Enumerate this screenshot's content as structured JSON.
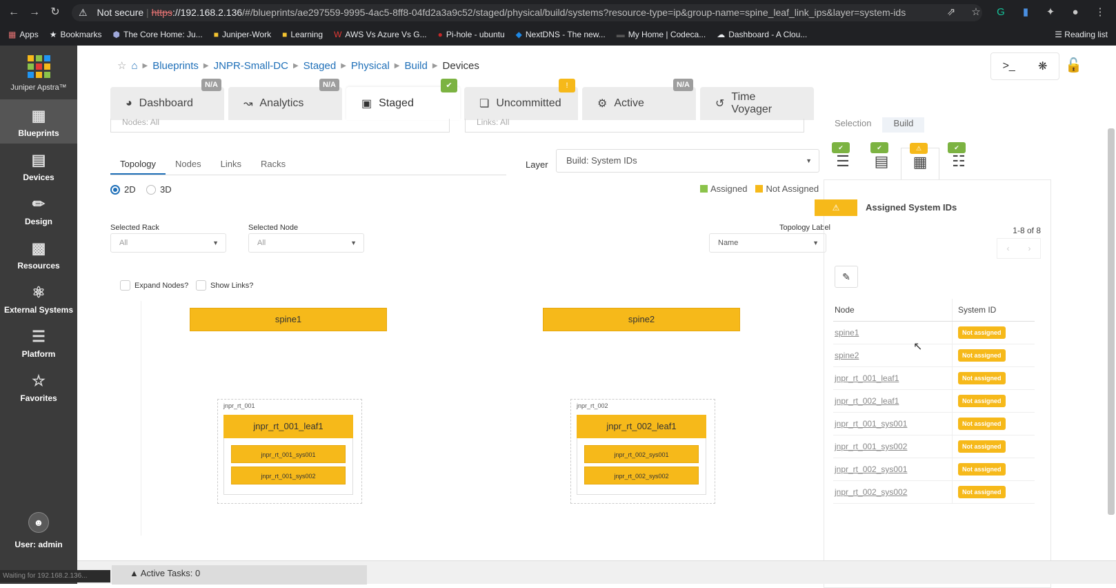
{
  "browser": {
    "security": "Not secure",
    "url_scheme": "https",
    "url_host": "://192.168.2.136",
    "url_path": "/#/blueprints/ae297559-9995-4ac5-8ff8-04fd2a3a9c52/staged/physical/build/systems?resource-type=ip&group-name=spine_leaf_link_ips&layer=system-ids",
    "bookmarks": [
      "Apps",
      "Bookmarks",
      "The Core Home: Ju...",
      "Juniper-Work",
      "Learning",
      "AWS Vs Azure Vs G...",
      "Pi-hole - ubuntu",
      "NextDNS - The new...",
      "My Home | Codeca...",
      "Dashboard - A Clou..."
    ],
    "reading_list": "Reading list",
    "status": "Waiting for 192.168.2.136..."
  },
  "sidebar": {
    "brand": "Juniper Apstra™",
    "items": [
      {
        "label": "Blueprints",
        "icon": "blueprints-icon"
      },
      {
        "label": "Devices",
        "icon": "devices-icon"
      },
      {
        "label": "Design",
        "icon": "design-icon"
      },
      {
        "label": "Resources",
        "icon": "resources-icon"
      },
      {
        "label": "External Systems",
        "icon": "external-systems-icon"
      },
      {
        "label": "Platform",
        "icon": "platform-icon"
      },
      {
        "label": "Favorites",
        "icon": "star-icon"
      }
    ],
    "user": "User: admin"
  },
  "breadcrumb": {
    "items": [
      "Blueprints",
      "JNPR-Small-DC",
      "Staged",
      "Physical",
      "Build"
    ],
    "current": "Devices"
  },
  "tabs": [
    {
      "label": "Dashboard",
      "badge": "N/A"
    },
    {
      "label": "Analytics",
      "badge": "N/A"
    },
    {
      "label": "Staged",
      "badge": "✔"
    },
    {
      "label": "Uncommitted",
      "badge": "!"
    },
    {
      "label": "Active",
      "badge": "N/A"
    },
    {
      "label": "Time Voyager",
      "badge": ""
    }
  ],
  "filters": {
    "nodes": "Nodes: All",
    "links": "Links: All"
  },
  "subtabs": [
    "Topology",
    "Nodes",
    "Links",
    "Racks"
  ],
  "view": {
    "option_2d": "2D",
    "option_3d": "3D"
  },
  "layer": {
    "label": "Layer",
    "value": "Build: System IDs"
  },
  "legend": {
    "assigned": "Assigned",
    "not_assigned": "Not Assigned",
    "assigned_color": "#8bc34a",
    "not_assigned_color": "#f6b91a"
  },
  "selectors": {
    "rack_label": "Selected Rack",
    "rack_value": "All",
    "node_label": "Selected Node",
    "node_value": "All",
    "topology_label": "Topology Label",
    "topology_value": "Name"
  },
  "checkboxes": {
    "expand": "Expand Nodes?",
    "links": "Show Links?"
  },
  "topology": {
    "spines": [
      "spine1",
      "spine2"
    ],
    "racks": [
      {
        "name": "jnpr_rt_001",
        "leaf": "jnpr_rt_001_leaf1",
        "systems": [
          "jnpr_rt_001_sys001",
          "jnpr_rt_001_sys002"
        ]
      },
      {
        "name": "jnpr_rt_002",
        "leaf": "jnpr_rt_002_leaf1",
        "systems": [
          "jnpr_rt_002_sys001",
          "jnpr_rt_002_sys002"
        ]
      }
    ]
  },
  "panel": {
    "tabs": [
      "Selection",
      "Build"
    ],
    "title": "Assigned System IDs",
    "pager": "1-8 of 8",
    "col_node": "Node",
    "col_sysid": "System ID",
    "rows": [
      {
        "node": "spine1",
        "status": "Not assigned"
      },
      {
        "node": "spine2",
        "status": "Not assigned"
      },
      {
        "node": "jnpr_rt_001_leaf1",
        "status": "Not assigned"
      },
      {
        "node": "jnpr_rt_002_leaf1",
        "status": "Not assigned"
      },
      {
        "node": "jnpr_rt_001_sys001",
        "status": "Not assigned"
      },
      {
        "node": "jnpr_rt_001_sys002",
        "status": "Not assigned"
      },
      {
        "node": "jnpr_rt_002_sys001",
        "status": "Not assigned"
      },
      {
        "node": "jnpr_rt_002_sys002",
        "status": "Not assigned"
      }
    ]
  },
  "footer": {
    "tasks": "Active Tasks: 0"
  }
}
